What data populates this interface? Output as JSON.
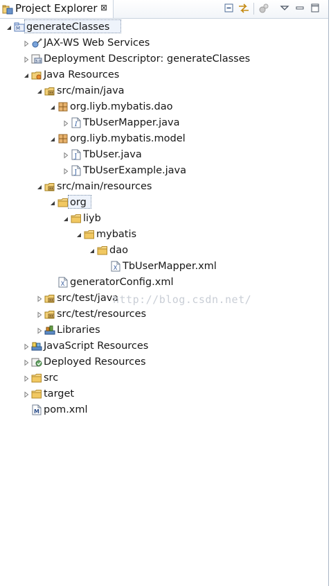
{
  "view": {
    "title": "Project Explorer",
    "close_glyph": "⊠"
  },
  "toolbar": {
    "buttons": [
      {
        "name": "collapse-all-icon"
      },
      {
        "name": "link-with-editor-icon"
      },
      {
        "name": "focus-on-active-task-icon"
      },
      {
        "name": "view-menu-chevron-down-icon"
      },
      {
        "name": "minimize-icon"
      },
      {
        "name": "maximize-icon"
      }
    ]
  },
  "tree": [
    {
      "label": "generateClasses",
      "icon": "maven-project-icon",
      "state": "open",
      "selected": true
    },
    {
      "label": "JAX-WS Web Services",
      "icon": "web-services-icon",
      "state": "closed"
    },
    {
      "label": "Deployment Descriptor: generateClasses",
      "icon": "deployment-descriptor-icon",
      "state": "closed"
    },
    {
      "label": "Java Resources",
      "icon": "java-resources-icon",
      "state": "open"
    },
    {
      "label": "src/main/java",
      "icon": "source-folder-icon",
      "state": "open"
    },
    {
      "label": "org.liyb.mybatis.dao",
      "icon": "package-icon",
      "state": "open"
    },
    {
      "label": "TbUserMapper.java",
      "icon": "java-interface-file-icon",
      "state": "closed"
    },
    {
      "label": "org.liyb.mybatis.model",
      "icon": "package-icon",
      "state": "open"
    },
    {
      "label": "TbUser.java",
      "icon": "java-file-icon",
      "state": "closed"
    },
    {
      "label": "TbUserExample.java",
      "icon": "java-file-icon",
      "state": "closed"
    },
    {
      "label": "src/main/resources",
      "icon": "source-folder-icon",
      "state": "open"
    },
    {
      "label": "org",
      "icon": "folder-icon",
      "state": "open",
      "focused": true
    },
    {
      "label": "liyb",
      "icon": "folder-icon",
      "state": "open"
    },
    {
      "label": "mybatis",
      "icon": "folder-icon",
      "state": "open"
    },
    {
      "label": "dao",
      "icon": "folder-icon",
      "state": "open"
    },
    {
      "label": "TbUserMapper.xml",
      "icon": "xml-file-icon",
      "state": "leaf"
    },
    {
      "label": "generatorConfig.xml",
      "icon": "xml-file-icon",
      "state": "leaf"
    },
    {
      "label": "src/test/java",
      "icon": "source-folder-icon",
      "state": "closed"
    },
    {
      "label": "src/test/resources",
      "icon": "source-folder-icon",
      "state": "closed"
    },
    {
      "label": "Libraries",
      "icon": "libraries-icon",
      "state": "closed"
    },
    {
      "label": "JavaScript Resources",
      "icon": "javascript-resources-icon",
      "state": "closed"
    },
    {
      "label": "Deployed Resources",
      "icon": "deployed-resources-icon",
      "state": "closed"
    },
    {
      "label": "src",
      "icon": "folder-icon",
      "state": "closed"
    },
    {
      "label": "target",
      "icon": "folder-icon",
      "state": "closed"
    },
    {
      "label": "pom.xml",
      "icon": "maven-pom-file-icon",
      "state": "leaf"
    }
  ],
  "watermark": "http://blog.csdn.net/"
}
